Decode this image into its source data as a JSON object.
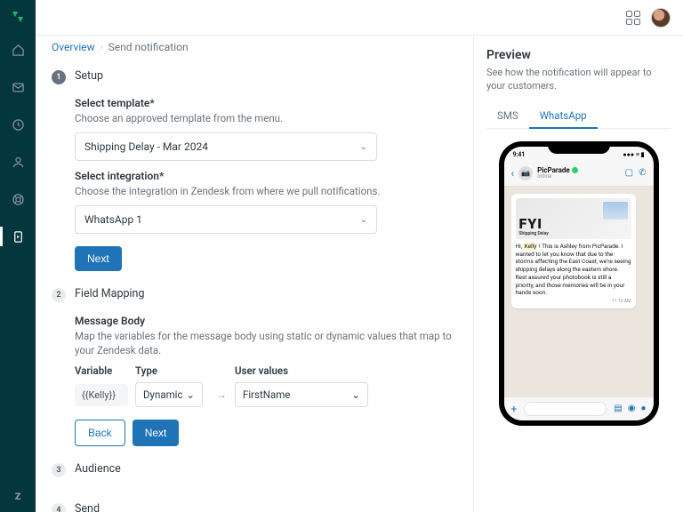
{
  "breadcrumb": {
    "root": "Overview",
    "current": "Send notification"
  },
  "steps": {
    "setup": {
      "num": "1",
      "title": "Setup"
    },
    "mapping": {
      "num": "2",
      "title": "Field Mapping"
    },
    "audience": {
      "num": "3",
      "title": "Audience"
    },
    "send": {
      "num": "4",
      "title": "Send"
    }
  },
  "setup": {
    "template_label": "Select template*",
    "template_help": "Choose an approved template from the menu.",
    "template_value": "Shipping Delay - Mar 2024",
    "integration_label": "Select integration*",
    "integration_help": "Choose the integration in Zendesk from where we pull notifications.",
    "integration_value": "WhatsApp 1",
    "next": "Next"
  },
  "mapping": {
    "body_title": "Message Body",
    "body_help": "Map the variables for the message body using static or dynamic values that map to your Zendesk data.",
    "headers": {
      "variable": "Variable",
      "type": "Type",
      "user_values": "User values"
    },
    "row": {
      "variable": "{{Kelly}}",
      "type": "Dynamic",
      "user_value": "FirstName"
    },
    "back": "Back",
    "next": "Next"
  },
  "preview": {
    "title": "Preview",
    "desc": "See how the notification will appear to your customers.",
    "tab_sms": "SMS",
    "tab_whatsapp": "WhatsApp"
  },
  "phone": {
    "time": "9:41",
    "contact": "PicParade",
    "status": "online",
    "fyi": "FYI",
    "fyi_sub": "Shipping Delay",
    "msg_pre": "Hi, ",
    "msg_name": "Kelly",
    "msg_post": " ! This is Ashley from PicParade. I wanted to let you know that due to the storms affecting the East Coast, we're seeing shipping delays along the eastern shore. Rest assured your photobook is still a priority, and those memories will be in your hands soon.",
    "msg_time": "11:16 AM"
  }
}
